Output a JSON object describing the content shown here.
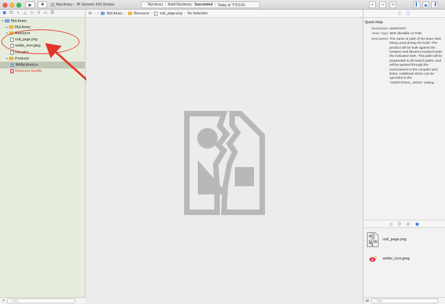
{
  "toolbar": {
    "scheme_target": "MyLibrary",
    "scheme_device": "Generic iOS Device",
    "activity_project": "MyLibrary",
    "activity_build": "Build MyLibrary:",
    "activity_status": "Succeeded",
    "activity_time": "Today at 下午5:00"
  },
  "navigator": {
    "items": [
      {
        "label": "MyLibrary",
        "level": 0,
        "kind": "project"
      },
      {
        "label": "MyLibrary",
        "level": 1,
        "kind": "folder"
      },
      {
        "label": "Resource",
        "level": 1,
        "kind": "folder"
      },
      {
        "label": "null_page.png",
        "level": 2,
        "kind": "file"
      },
      {
        "label": "weibo_icon.jpeg",
        "level": 2,
        "kind": "file"
      },
      {
        "label": "Info.plist",
        "level": 2,
        "kind": "file"
      },
      {
        "label": "Products",
        "level": 1,
        "kind": "folder"
      },
      {
        "label": "libMyLibrary.a",
        "level": 2,
        "kind": "lib"
      },
      {
        "label": "Resource.bundle",
        "level": 2,
        "kind": "bundle"
      }
    ],
    "filter_placeholder": "Filter"
  },
  "jumpbar": {
    "crumbs": [
      "MyLibrary",
      "Resource",
      "null_page.png",
      "No Selection"
    ]
  },
  "quick_help": {
    "title": "Quick Help",
    "declaration_label": "Declaration",
    "declaration_value": "SDKROOT",
    "value_type_label": "Value Type",
    "value_type_value": "SDK identifier or Path",
    "description_label": "Description",
    "description_value": "The name or path of the base SDK being used during the build. The product will be built against the headers and libraries located inside the indicated SDK. This path will be prepended to all search paths, and will be passed through the environment to the compiler and linker. Additional SDKs can be specified in the \"ADDITIONAL_SDKS\" setting."
  },
  "library": {
    "items": [
      {
        "label": "null_page.png"
      },
      {
        "label": "weibo_icon.jpeg"
      }
    ],
    "filter_placeholder": "Filter"
  },
  "colors": {
    "annotation": "#e5352b",
    "navigator_bg": "#e6eddc",
    "accent": "#2b6de4"
  }
}
